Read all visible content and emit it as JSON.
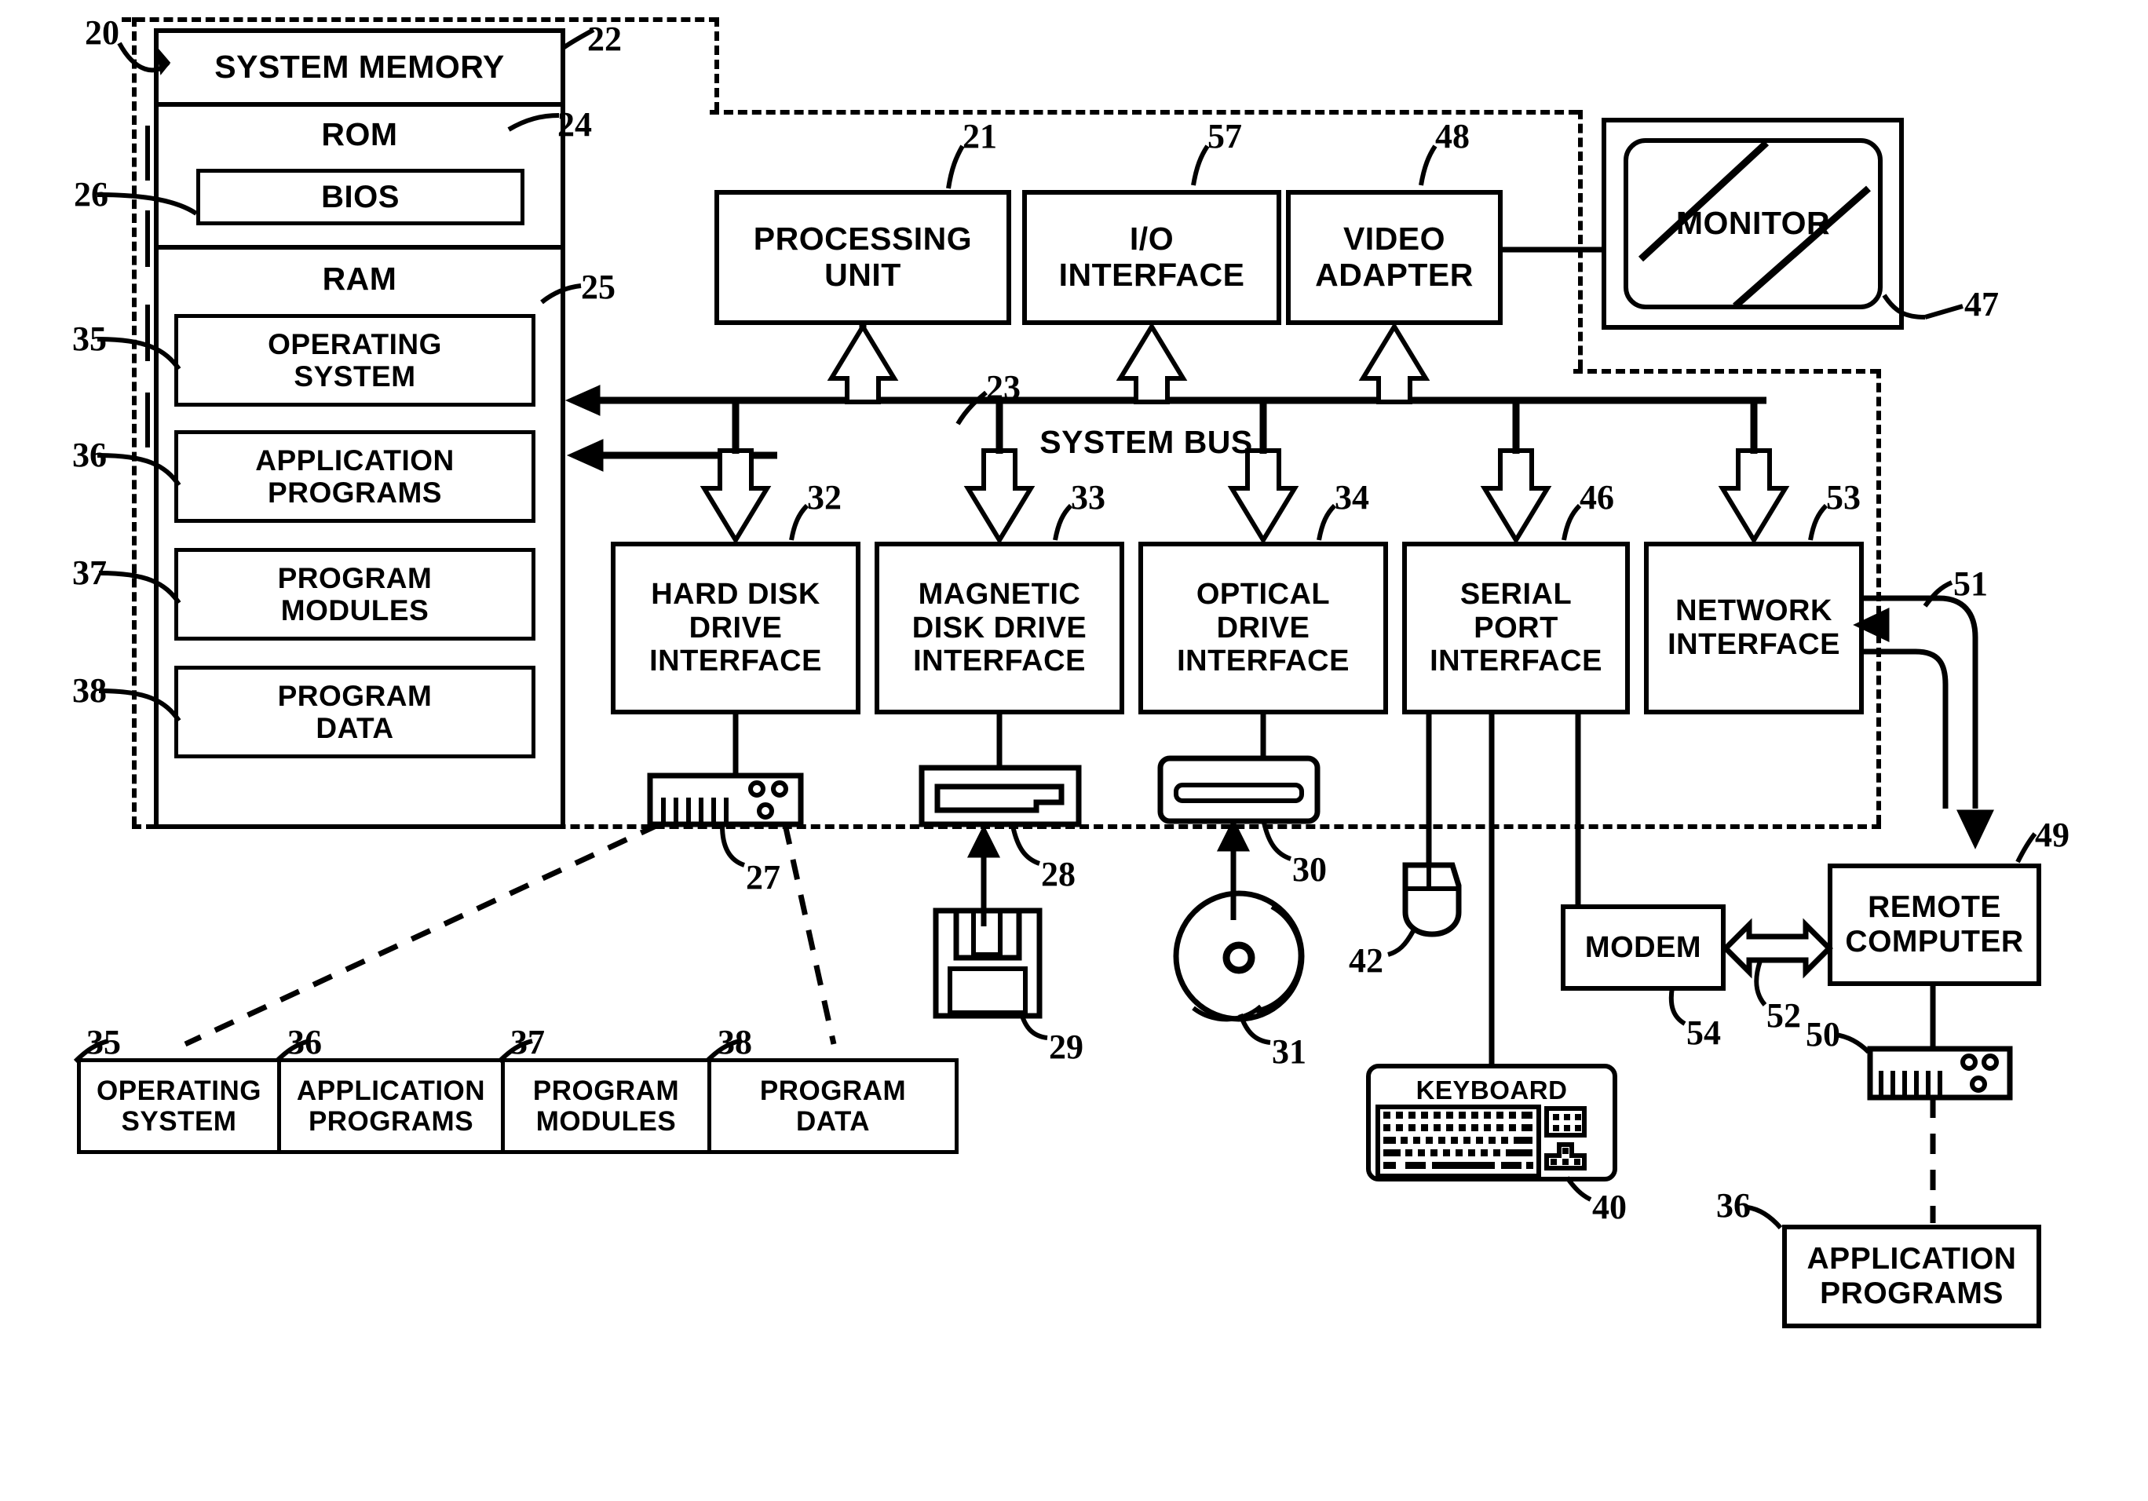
{
  "figure": {
    "title": "Computer system block diagram",
    "ink_color": "#000000",
    "background": "#ffffff"
  },
  "system_memory": {
    "title": "SYSTEM MEMORY",
    "ref": "22",
    "outer_ref": "20",
    "sections": [
      {
        "label": "ROM",
        "ref": "24"
      },
      {
        "label": "RAM",
        "ref": "25"
      }
    ],
    "blocks": [
      {
        "label": "BIOS",
        "ref": "26"
      },
      {
        "label": "OPERATING\nSYSTEM",
        "ref": "35"
      },
      {
        "label": "APPLICATION\nPROGRAMS",
        "ref": "36"
      },
      {
        "label": "PROGRAM\nMODULES",
        "ref": "37"
      },
      {
        "label": "PROGRAM\nDATA",
        "ref": "38"
      }
    ]
  },
  "top_row": [
    {
      "label": "PROCESSING\nUNIT",
      "ref": "21"
    },
    {
      "label": "I/O\nINTERFACE",
      "ref": "57"
    },
    {
      "label": "VIDEO\nADAPTER",
      "ref": "48"
    }
  ],
  "monitor": {
    "label": "MONITOR",
    "ref": "47"
  },
  "bus": {
    "label": "SYSTEM BUS",
    "ref": "23"
  },
  "interface_row": [
    {
      "label": "HARD DISK\nDRIVE\nINTERFACE",
      "ref": "32"
    },
    {
      "label": "MAGNETIC\nDISK DRIVE\nINTERFACE",
      "ref": "33"
    },
    {
      "label": "OPTICAL\nDRIVE\nINTERFACE",
      "ref": "34"
    },
    {
      "label": "SERIAL\nPORT\nINTERFACE",
      "ref": "46"
    },
    {
      "label": "NETWORK\nINTERFACE",
      "ref": "53"
    }
  ],
  "devices": {
    "hard_disk_drive": {
      "ref": "27",
      "icon": "hard-disk-drive-icon"
    },
    "magnetic_disk_drive": {
      "ref": "28",
      "icon": "floppy-drive-icon"
    },
    "floppy_disk": {
      "ref": "29",
      "icon": "floppy-disk-icon"
    },
    "optical_drive": {
      "ref": "30",
      "icon": "optical-drive-icon"
    },
    "optical_disk": {
      "ref": "31",
      "icon": "compact-disc-icon"
    },
    "mouse": {
      "ref": "42",
      "icon": "mouse-icon"
    },
    "keyboard": {
      "label": "KEYBOARD",
      "ref": "40",
      "icon": "keyboard-icon"
    },
    "remote_nic": {
      "ref": "50",
      "icon": "hard-disk-drive-icon"
    }
  },
  "stored_programs": [
    {
      "label": "OPERATING\nSYSTEM",
      "ref": "35"
    },
    {
      "label": "APPLICATION\nPROGRAMS",
      "ref": "36"
    },
    {
      "label": "PROGRAM\nMODULES",
      "ref": "37"
    },
    {
      "label": "PROGRAM\nDATA",
      "ref": "38"
    }
  ],
  "network": {
    "modem": {
      "label": "MODEM",
      "ref": "54"
    },
    "wan_link_ref": "52",
    "lan_link_ref": "51",
    "remote_computer": {
      "label": "REMOTE\nCOMPUTER",
      "ref": "49"
    },
    "remote_application_programs": {
      "label": "APPLICATION\nPROGRAMS",
      "ref": "36"
    }
  }
}
